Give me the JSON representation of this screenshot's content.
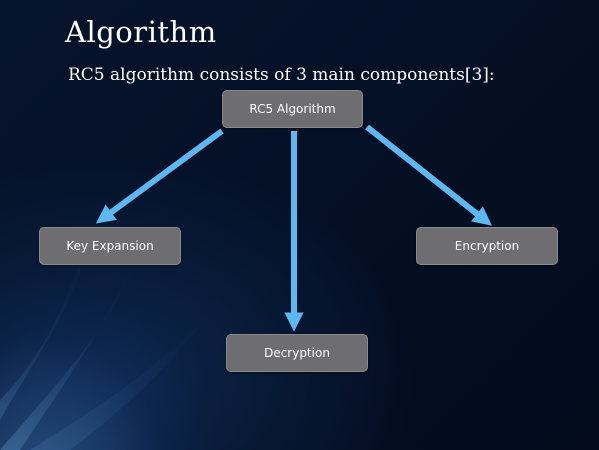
{
  "slide": {
    "title": "Algorithm",
    "subtitle": "RC5 algorithm consists of 3 main components[3]:"
  },
  "diagram": {
    "root": "RC5 Algorithm",
    "children": [
      "Key Expansion",
      "Decryption",
      "Encryption"
    ]
  },
  "colors": {
    "background": "#050f20",
    "node_fill": "#6e6e70",
    "arrow": "#5bb8f0",
    "text": "#ffffff"
  }
}
